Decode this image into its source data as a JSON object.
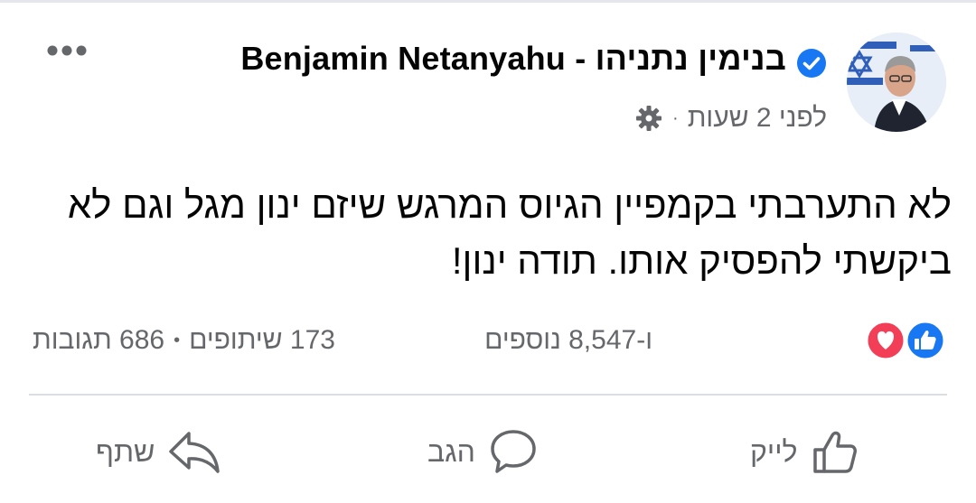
{
  "post": {
    "author": "Benjamin Netanyahu - בנימין נתניהו",
    "time": "לפני 2 שעות",
    "separator": "·",
    "text_lines": [
      "לא התערבתי בקמפיין הגיוס המרגש שיזם ינון מגל וגם לא",
      "ביקשתי להפסיק אותו. תודה ינון!"
    ]
  },
  "stats": {
    "reactions_text": "ו-8,547 נוספים",
    "comments": "686 תגובות",
    "separator": "•",
    "shares": "173 שיתופים"
  },
  "actions": {
    "like": "לייק",
    "comment": "הגב",
    "share": "שתף"
  },
  "icons": {
    "verified": "verified-badge-icon",
    "privacy": "gear-icon",
    "more": "more-options-icon",
    "like_reaction": "thumbs-up-icon",
    "love_reaction": "heart-icon"
  },
  "colors": {
    "accent": "#1877f2",
    "love": "#f33e58",
    "secondary_text": "#65676b",
    "divider": "#dadde1"
  }
}
